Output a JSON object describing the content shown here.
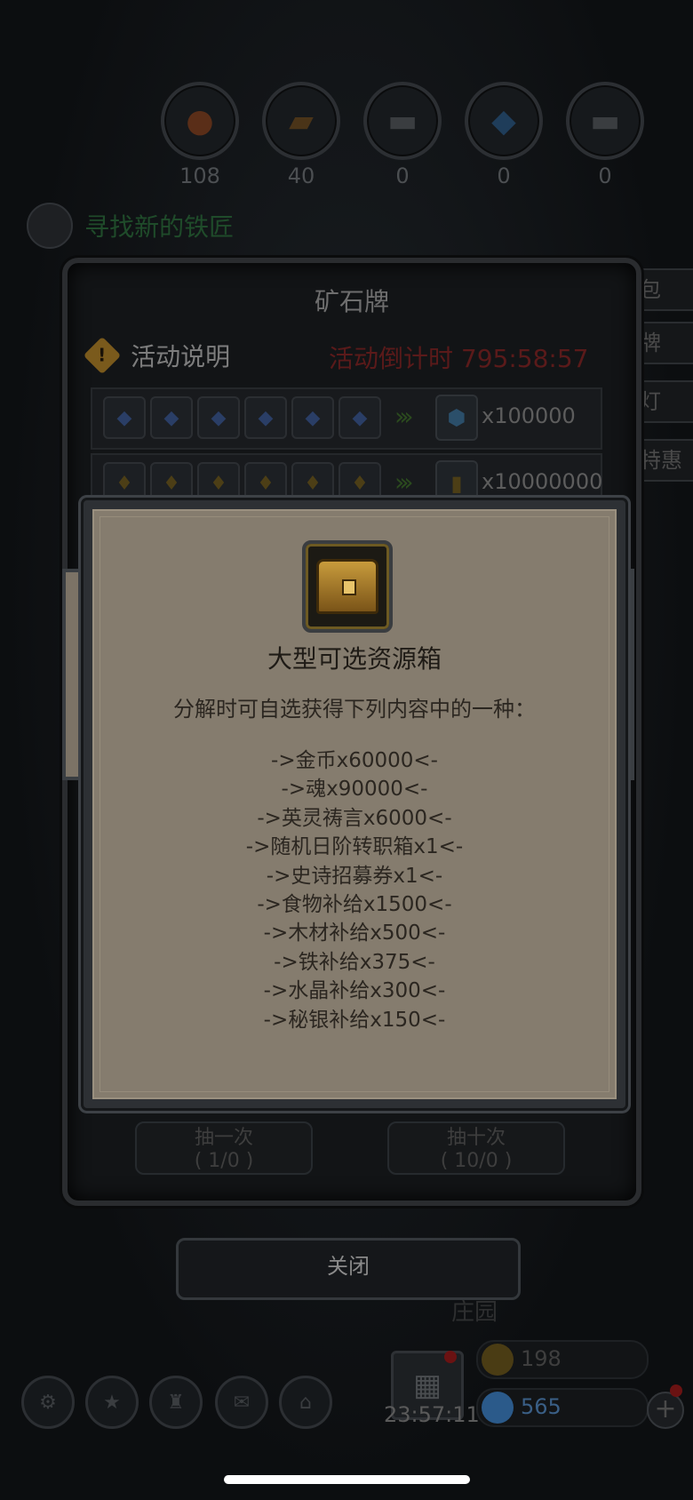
{
  "resources": [
    {
      "name": "food",
      "icon": "meat-icon",
      "value": "108"
    },
    {
      "name": "wood",
      "icon": "wood-icon",
      "value": "40"
    },
    {
      "name": "iron",
      "icon": "iron-icon",
      "value": "0"
    },
    {
      "name": "crystal",
      "icon": "crystal-icon",
      "value": "0"
    },
    {
      "name": "mithril",
      "icon": "mithril-icon",
      "value": "0"
    }
  ],
  "quest": {
    "label": "寻找新的铁匠"
  },
  "panel": {
    "title": "矿石牌",
    "activity_info": "活动说明",
    "countdown": "活动倒计时 795:58:57",
    "trade_rows": [
      {
        "reward_qty": "x100000"
      },
      {
        "reward_qty": "x10000000"
      }
    ],
    "draw_once": {
      "label": "抽一次",
      "count": "( 1/0 )"
    },
    "draw_ten": {
      "label": "抽十次",
      "count": "( 10/0 )"
    }
  },
  "side_tabs": [
    "包",
    "牌",
    "灯",
    "特惠"
  ],
  "popup": {
    "item_name": "大型可选资源箱",
    "description": "分解时可自选获得下列内容中的一种：",
    "options": [
      "->金币x60000<-",
      "->魂x90000<-",
      "->英灵祷言x6000<-",
      "->随机日阶转职箱x1<-",
      "->史诗招募券x1<-",
      "->食物补给x1500<-",
      "->木材补给x500<-",
      "->铁补给x375<-",
      "->水晶补给x300<-",
      "->秘银补给x150<-"
    ]
  },
  "close_button": "关闭",
  "location_label": "庄园",
  "bottom_bar": {
    "time": "23:57:11",
    "gold": "198",
    "gems": "565"
  },
  "colors": {
    "popup_bg": "#857c6e",
    "countdown_red": "#5a1a1a",
    "gem_blue": "#2b5a8a"
  }
}
